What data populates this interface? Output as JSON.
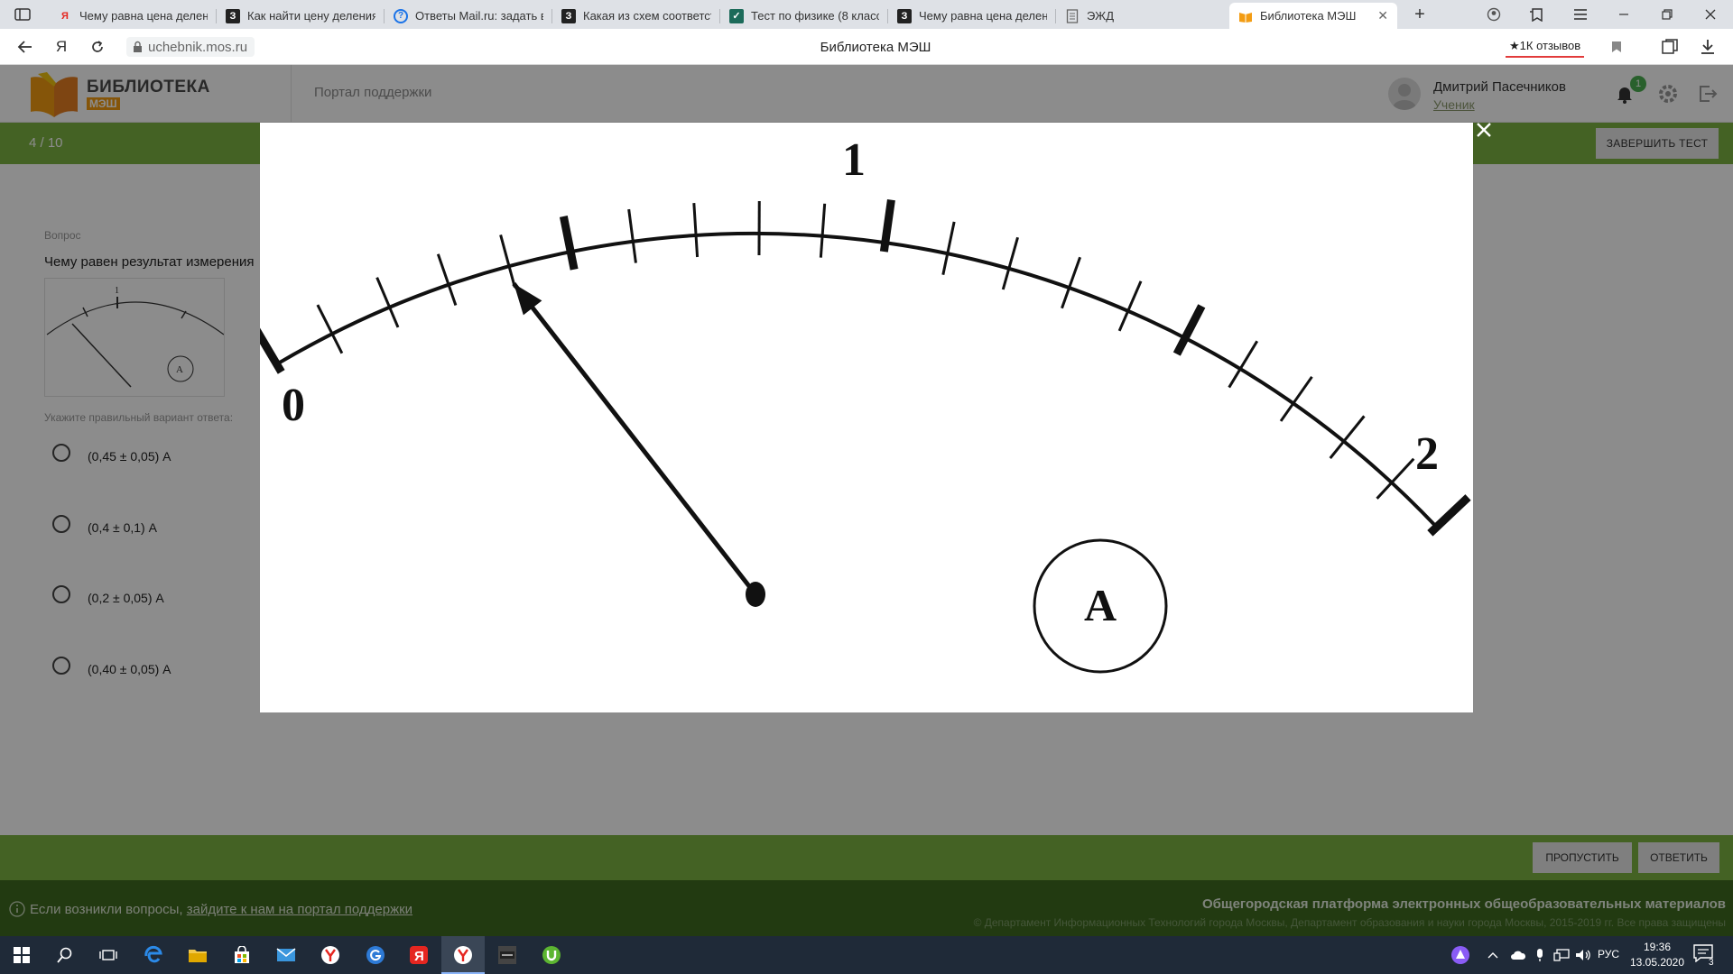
{
  "browser": {
    "tabs": [
      {
        "title": "Чему равна цена делен",
        "icon": "yandex-icon"
      },
      {
        "title": "Как найти цену деления",
        "icon": "znanija-icon"
      },
      {
        "title": "Ответы Mail.ru: задать во",
        "icon": "mailru-answers-icon"
      },
      {
        "title": "Какая из схем соответст",
        "icon": "znanija-icon"
      },
      {
        "title": "Тест по физике (8 класс)",
        "icon": "check-icon"
      },
      {
        "title": "Чему равна цена делен",
        "icon": "znanija-icon"
      },
      {
        "title": "ЭЖД",
        "icon": "document-icon"
      },
      {
        "title": "Библиотека МЭШ",
        "icon": "mesh-book-icon",
        "active": true
      }
    ],
    "url": "uchebnik.mos.ru",
    "page_title": "Библиотека МЭШ",
    "reviews": "★1К отзывов"
  },
  "site": {
    "logo_line1": "БИБЛИОТЕКА",
    "logo_line2": "МЭШ",
    "support_link": "Портал поддержки",
    "user_name": "Дмитрий Пасечников",
    "user_role": "Ученик",
    "notifications": "1"
  },
  "test": {
    "progress": "4 / 10",
    "finish_label": "ЗАВЕРШИТЬ ТЕСТ",
    "question_caption": "Вопрос",
    "question_text": "Чему равен результат измерения",
    "answer_hint": "Укажите правильный вариант ответа:",
    "answers": [
      "(0,45 ± 0,05) А",
      "(0,4 ± 0,1) А",
      "(0,2 ± 0,05) А",
      "(0,40 ± 0,05) А"
    ],
    "skip_label": "ПРОПУСТИТЬ",
    "answer_label": "ОТВЕТИТЬ"
  },
  "meter": {
    "scale_labels": [
      "0",
      "1",
      "2"
    ],
    "unit": "A",
    "needle_value": 0.4,
    "scale_min": 0,
    "scale_max": 2,
    "divisions": 20
  },
  "footer": {
    "question_prefix": "Если возникли вопросы,",
    "question_link": "зайдите к нам на портал поддержки",
    "platform_title": "Общегородская платформа электронных общеобразовательных материалов",
    "copyright": "© Департамент Информационных Технологий города Москвы, Департамент образования и науки города Москвы, 2015-2019 гг. Все права защищены"
  },
  "taskbar": {
    "lang": "РУС",
    "time": "19:36",
    "date": "13.05.2020",
    "notification_count": "3"
  }
}
